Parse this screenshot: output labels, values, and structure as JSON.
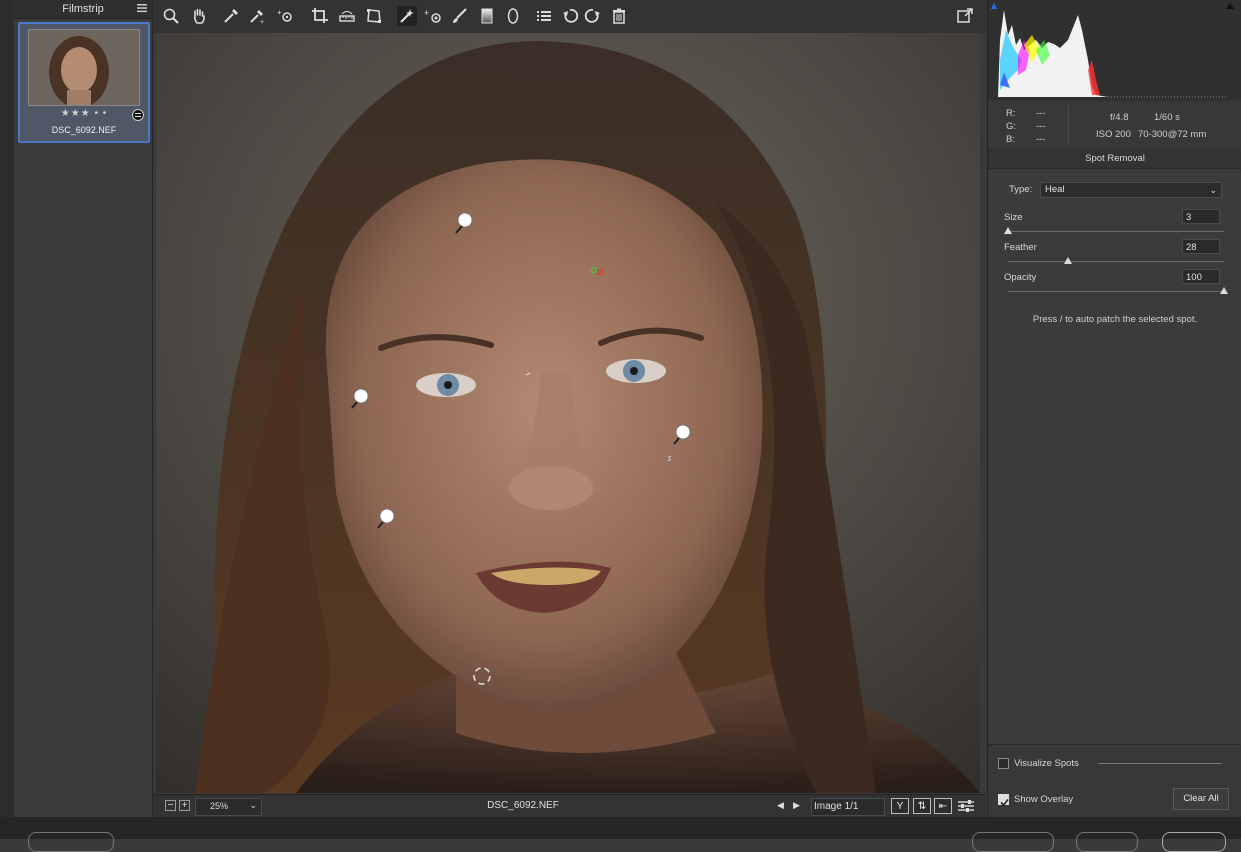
{
  "filmstrip": {
    "title": "Filmstrip",
    "items": [
      {
        "filename": "DSC_6092.NEF",
        "rating": "★★★ • •"
      }
    ]
  },
  "toolbar": {
    "tools": [
      "zoom-tool",
      "hand-tool",
      "white-balance-tool",
      "color-sampler-tool",
      "targeted-adjustment-tool",
      "crop-tool",
      "straighten-tool",
      "transform-tool",
      "spot-removal-tool",
      "red-eye-tool",
      "adjustment-brush-tool",
      "graduated-filter-tool",
      "radial-filter-tool",
      "preferences-tool",
      "rotate-left-tool",
      "rotate-right-tool",
      "trash-tool"
    ],
    "active_tool": "spot-removal-tool"
  },
  "statusbar": {
    "zoom": "25%",
    "filename": "DSC_6092.NEF",
    "image_counter": "Image 1/1",
    "view_y_label": "Y"
  },
  "exif": {
    "r_label": "R:",
    "r_value": "---",
    "g_label": "G:",
    "g_value": "---",
    "b_label": "B:",
    "b_value": "---",
    "aperture": "f/4.8",
    "shutter": "1/60 s",
    "iso": "ISO 200",
    "lens": "70-300@72 mm"
  },
  "spot_removal": {
    "title": "Spot Removal",
    "type_label": "Type:",
    "type_value": "Heal",
    "size_label": "Size",
    "size_value": "3",
    "size_fraction": 0.0,
    "feather_label": "Feather",
    "feather_value": "28",
    "feather_fraction": 0.28,
    "opacity_label": "Opacity",
    "opacity_value": "100",
    "opacity_fraction": 1.0,
    "hint": "Press / to auto patch the selected spot.",
    "visualize_spots_label": "Visualize Spots",
    "visualize_spots_checked": false,
    "show_overlay_label": "Show Overlay",
    "show_overlay_checked": true,
    "clear_all_label": "Clear All"
  },
  "colors": {
    "accent": "#4a78c9",
    "panel": "#333333",
    "canvas_bg": "#2e2b28"
  }
}
